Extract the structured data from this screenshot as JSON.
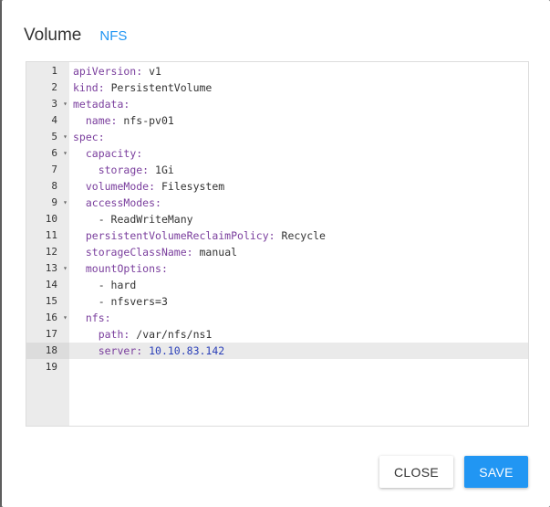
{
  "dialog": {
    "title": "Volume",
    "subtitle": "NFS"
  },
  "editor": {
    "active_line": 18,
    "lines": [
      {
        "n": "1",
        "fold": "",
        "indent": "",
        "key": "apiVersion",
        "sep": ": ",
        "val": "v1"
      },
      {
        "n": "2",
        "fold": "",
        "indent": "",
        "key": "kind",
        "sep": ": ",
        "val": "PersistentVolume"
      },
      {
        "n": "3",
        "fold": "▾",
        "indent": "",
        "key": "metadata",
        "sep": ":",
        "val": ""
      },
      {
        "n": "4",
        "fold": "",
        "indent": "  ",
        "key": "name",
        "sep": ": ",
        "val": "nfs-pv01"
      },
      {
        "n": "5",
        "fold": "▾",
        "indent": "",
        "key": "spec",
        "sep": ":",
        "val": ""
      },
      {
        "n": "6",
        "fold": "▾",
        "indent": "  ",
        "key": "capacity",
        "sep": ":",
        "val": ""
      },
      {
        "n": "7",
        "fold": "",
        "indent": "    ",
        "key": "storage",
        "sep": ": ",
        "val": "1Gi"
      },
      {
        "n": "8",
        "fold": "",
        "indent": "  ",
        "key": "volumeMode",
        "sep": ": ",
        "val": "Filesystem"
      },
      {
        "n": "9",
        "fold": "▾",
        "indent": "  ",
        "key": "accessModes",
        "sep": ":",
        "val": ""
      },
      {
        "n": "10",
        "fold": "",
        "indent": "    ",
        "key": "",
        "sep": "",
        "val": "- ReadWriteMany"
      },
      {
        "n": "11",
        "fold": "",
        "indent": "  ",
        "key": "persistentVolumeReclaimPolicy",
        "sep": ": ",
        "val": "Recycle"
      },
      {
        "n": "12",
        "fold": "",
        "indent": "  ",
        "key": "storageClassName",
        "sep": ": ",
        "val": "manual"
      },
      {
        "n": "13",
        "fold": "▾",
        "indent": "  ",
        "key": "mountOptions",
        "sep": ":",
        "val": ""
      },
      {
        "n": "14",
        "fold": "",
        "indent": "    ",
        "key": "",
        "sep": "",
        "val": "- hard"
      },
      {
        "n": "15",
        "fold": "",
        "indent": "    ",
        "key": "",
        "sep": "",
        "val": "- nfsvers=3"
      },
      {
        "n": "16",
        "fold": "▾",
        "indent": "  ",
        "key": "nfs",
        "sep": ":",
        "val": ""
      },
      {
        "n": "17",
        "fold": "",
        "indent": "    ",
        "key": "path",
        "sep": ": ",
        "val": "/var/nfs/ns1"
      },
      {
        "n": "18",
        "fold": "",
        "indent": "    ",
        "key": "server",
        "sep": ": ",
        "val": "10.10.83.142"
      },
      {
        "n": "19",
        "fold": "",
        "indent": "",
        "key": "",
        "sep": "",
        "val": ""
      }
    ]
  },
  "actions": {
    "close_label": "CLOSE",
    "save_label": "SAVE"
  },
  "colors": {
    "accent": "#2196f3",
    "yaml_key": "#7a3e9d",
    "yaml_number": "#2a3fb8"
  }
}
